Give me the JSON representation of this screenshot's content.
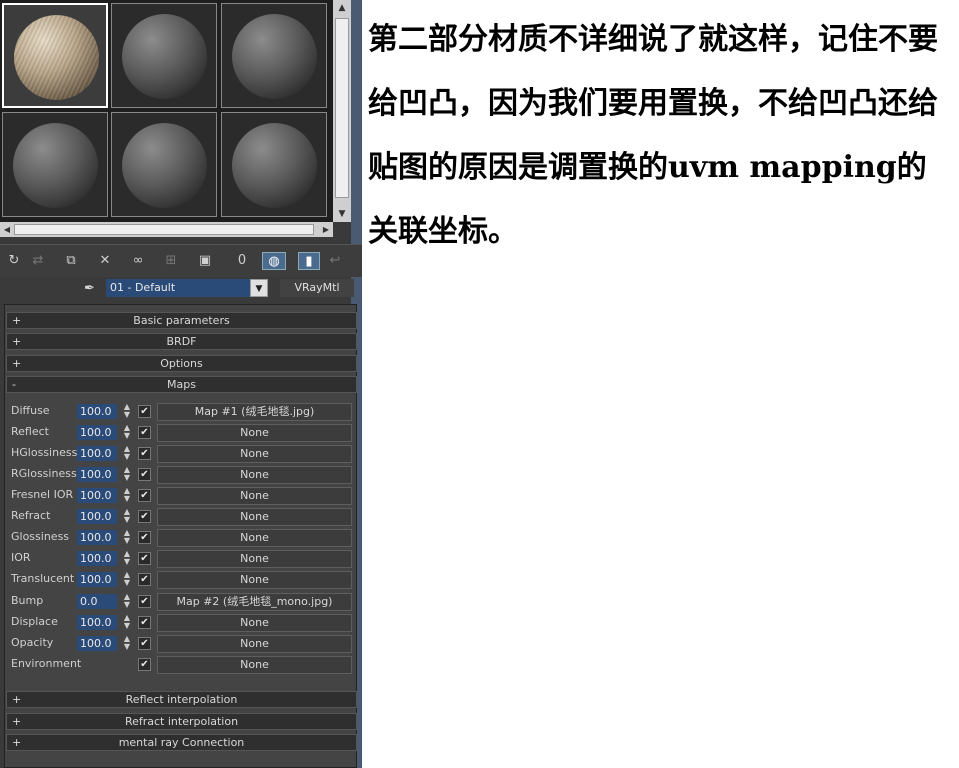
{
  "editor": {
    "material_name": "01 - Default",
    "material_type": "VRayMtl",
    "picker_icon": "eyedropper-icon",
    "toolbar_icons": [
      "get-material-icon",
      "put-material-icon",
      "assign-material-icon",
      "reset-icon",
      "make-unique-icon",
      "put-to-library-icon",
      "material-id-icon",
      "show-map-icon",
      "show-in-viewport-icon",
      "background-icon",
      "sample-type-icon"
    ],
    "rollouts_top": [
      {
        "sign": "+",
        "label": "Basic parameters"
      },
      {
        "sign": "+",
        "label": "BRDF"
      },
      {
        "sign": "+",
        "label": "Options"
      },
      {
        "sign": "-",
        "label": "Maps"
      }
    ],
    "maps": [
      {
        "label": "Diffuse",
        "value": "100.0",
        "checked": "✔",
        "map": "Map #1 (绒毛地毯.jpg)"
      },
      {
        "label": "Reflect",
        "value": "100.0",
        "checked": "✔",
        "map": "None"
      },
      {
        "label": "HGlossiness",
        "value": "100.0",
        "checked": "✔",
        "map": "None"
      },
      {
        "label": "RGlossiness",
        "value": "100.0",
        "checked": "✔",
        "map": "None"
      },
      {
        "label": "Fresnel IOR",
        "value": "100.0",
        "checked": "✔",
        "map": "None"
      },
      {
        "label": "Refract",
        "value": "100.0",
        "checked": "✔",
        "map": "None"
      },
      {
        "label": "Glossiness",
        "value": "100.0",
        "checked": "✔",
        "map": "None"
      },
      {
        "label": "IOR",
        "value": "100.0",
        "checked": "✔",
        "map": "None"
      },
      {
        "label": "Translucent",
        "value": "100.0",
        "checked": "✔",
        "map": "None"
      },
      {
        "label": "Bump",
        "value": "0.0",
        "checked": "✔",
        "map": "Map #2 (绒毛地毯_mono.jpg)"
      },
      {
        "label": "Displace",
        "value": "100.0",
        "checked": "✔",
        "map": "None"
      },
      {
        "label": "Opacity",
        "value": "100.0",
        "checked": "✔",
        "map": "None"
      },
      {
        "label": "Environment",
        "value": "",
        "checked": "✔",
        "map": "None"
      }
    ],
    "rollouts_bottom": [
      {
        "sign": "+",
        "label": "Reflect interpolation"
      },
      {
        "sign": "+",
        "label": "Refract interpolation"
      },
      {
        "sign": "+",
        "label": "mental ray Connection"
      }
    ]
  },
  "note": "第二部分材质不详细说了就这样，记住不要给凹凸，因为我们要用置换，不给凹凸还给贴图的原因是调置换的uvm mapping的关联坐标。"
}
